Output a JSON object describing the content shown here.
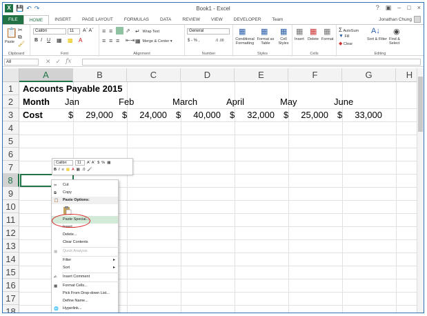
{
  "window": {
    "title": "Book1 - Excel",
    "help": "?",
    "controls": [
      "–",
      "□",
      "×"
    ]
  },
  "user": {
    "name": "Jonathan Chung"
  },
  "tabs": [
    {
      "label": "FILE"
    },
    {
      "label": "HOME"
    },
    {
      "label": "INSERT"
    },
    {
      "label": "PAGE LAYOUT"
    },
    {
      "label": "FORMULAS"
    },
    {
      "label": "DATA"
    },
    {
      "label": "REVIEW"
    },
    {
      "label": "VIEW"
    },
    {
      "label": "DEVELOPER"
    },
    {
      "label": "Team"
    }
  ],
  "ribbon": {
    "clipboard": {
      "label": "Clipboard",
      "paste": "Paste"
    },
    "font": {
      "label": "Font",
      "name": "Calibri",
      "size": "11",
      "bold": "B",
      "italic": "I",
      "underline": "U"
    },
    "alignment": {
      "label": "Alignment",
      "wrap": "Wrap Text",
      "merge": "Merge & Center"
    },
    "number": {
      "label": "Number",
      "format": "General",
      "currency": "$ - % ,",
      "decimals": ".0 .00"
    },
    "styles": {
      "label": "Styles",
      "conditional": "Conditional Formatting",
      "format_table": "Format as Table",
      "cell_styles": "Cell Styles"
    },
    "cells": {
      "label": "Cells",
      "insert": "Insert",
      "delete": "Delete",
      "format": "Format"
    },
    "editing": {
      "label": "Editing",
      "autosum": "AutoSum",
      "fill": "Fill",
      "clear": "Clear",
      "sort": "Sort & Filter",
      "find": "Find & Select"
    }
  },
  "formula_bar": {
    "name_box": "A8",
    "fx": "fx",
    "value": ""
  },
  "columns": [
    "A",
    "B",
    "C",
    "D",
    "E",
    "F",
    "G",
    "H"
  ],
  "rows": [
    "1",
    "2",
    "3",
    "4",
    "5",
    "6",
    "7",
    "8",
    "9",
    "10",
    "11",
    "12",
    "13",
    "14",
    "15",
    "16",
    "17",
    "18"
  ],
  "sheet": {
    "title": "Accounts Payable 2015",
    "month_label": "Month",
    "cost_label": "Cost",
    "currency": "$",
    "months": [
      "Jan",
      "Feb",
      "March",
      "April",
      "May",
      "June"
    ],
    "costs": [
      "29,000",
      "24,000",
      "40,000",
      "32,000",
      "25,000",
      "33,000"
    ]
  },
  "mini_toolbar": {
    "font": "Calibri",
    "size": "11",
    "currency": "$",
    "percent": "%",
    "bold": "B",
    "italic": "I"
  },
  "context_menu": {
    "cut": "Cut",
    "copy": "Copy",
    "paste_options": "Paste Options:",
    "paste_special": "Paste Special...",
    "insert": "Insert...",
    "delete": "Delete...",
    "clear": "Clear Contents",
    "quick_analysis": "Quick Analysis",
    "filter": "Filter",
    "sort": "Sort",
    "insert_comment": "Insert Comment",
    "format_cells": "Format Cells...",
    "pick_list": "Pick From Drop-down List...",
    "define_name": "Define Name...",
    "hyperlink": "Hyperlink..."
  },
  "colors": {
    "excel_green": "#217346",
    "highlight": "#d4ead9",
    "annotation": "#d62020"
  }
}
